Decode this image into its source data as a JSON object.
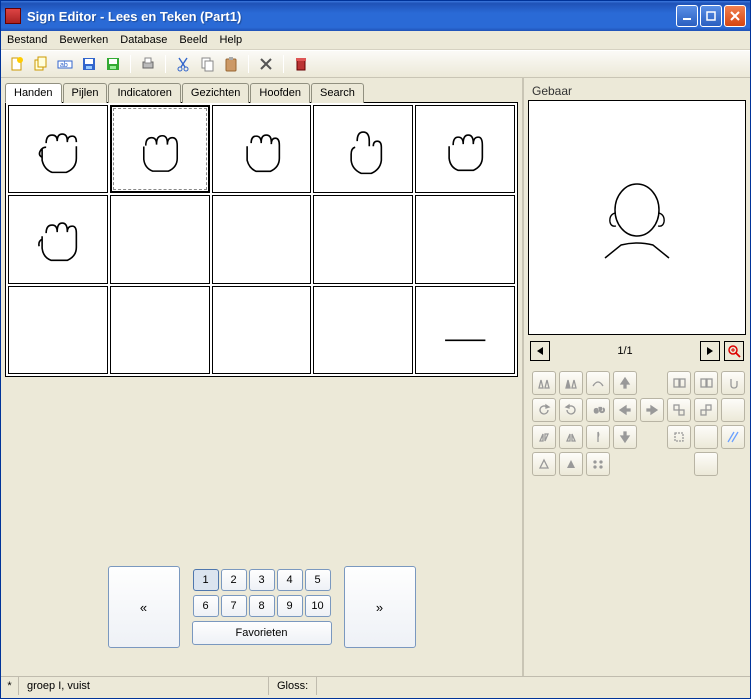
{
  "window": {
    "title": "Sign Editor - Lees en Teken (Part1)"
  },
  "menu": {
    "items": [
      "Bestand",
      "Bewerken",
      "Database",
      "Beeld",
      "Help"
    ]
  },
  "tabs": [
    {
      "label": "Handen",
      "active": true
    },
    {
      "label": "Pijlen",
      "active": false
    },
    {
      "label": "Indicatoren",
      "active": false
    },
    {
      "label": "Gezichten",
      "active": false
    },
    {
      "label": "Hoofden",
      "active": false
    },
    {
      "label": "Search",
      "active": false
    }
  ],
  "pager": {
    "prev": "«",
    "next": "»",
    "numbers": [
      "1",
      "2",
      "3",
      "4",
      "5",
      "6",
      "7",
      "8",
      "9",
      "10"
    ],
    "active": "1",
    "favorites": "Favorieten"
  },
  "right": {
    "label": "Gebaar",
    "page": "1/1"
  },
  "status": {
    "star": "*",
    "group": "groep I, vuist",
    "gloss_label": "Gloss:"
  },
  "toolbar_icons": [
    "new-doc",
    "copy-doc",
    "rename",
    "save",
    "save-db",
    "print",
    "cut",
    "copy",
    "paste",
    "delete",
    "trash"
  ],
  "tool_matrix_icons": [
    "flip-h",
    "flip-v",
    "arc",
    "arrow-up",
    "dup-right",
    "dup-r2",
    "hand",
    "rotate-ccw",
    "rotate-cw",
    "rotate-e",
    "arrow-left",
    "arrow-right",
    "stack-left",
    "stack-right",
    "blank",
    "mirror-1",
    "mirror-2",
    "half",
    "arrow-down",
    "bounds",
    "blank",
    "diag",
    "tri-up",
    "tri-up2",
    "dots"
  ]
}
